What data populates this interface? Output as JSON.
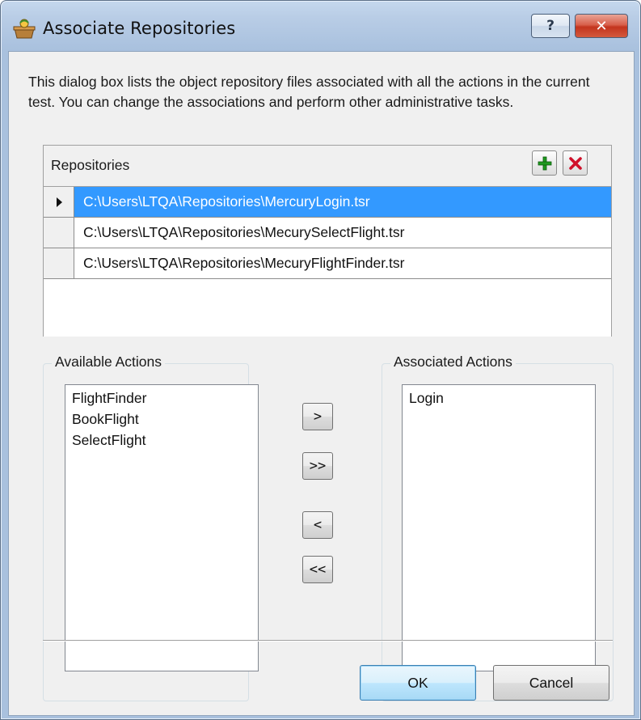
{
  "window": {
    "title": "Associate Repositories",
    "help_label": "?",
    "close_label": "✕"
  },
  "description": "This dialog box lists the object repository files associated with all the actions in the current test. You can change the associations and perform other administrative tasks.",
  "repositories": {
    "header": "Repositories",
    "add_icon": "plus-icon",
    "remove_icon": "delete-icon",
    "items": [
      "C:\\Users\\LTQA\\Repositories\\MercuryLogin.tsr",
      "C:\\Users\\LTQA\\Repositories\\MecurySelectFlight.tsr",
      "C:\\Users\\LTQA\\Repositories\\MecuryFlightFinder.tsr"
    ],
    "selected_index": 0
  },
  "available_actions": {
    "label": "Available Actions",
    "items": [
      "FlightFinder",
      "BookFlight",
      "SelectFlight"
    ]
  },
  "associated_actions": {
    "label": "Associated Actions",
    "items": [
      "Login"
    ]
  },
  "move_buttons": {
    "add_one": ">",
    "add_all": ">>",
    "remove_one": "<",
    "remove_all": "<<"
  },
  "footer": {
    "ok_label": "OK",
    "cancel_label": "Cancel"
  },
  "colors": {
    "selection": "#3399ff",
    "add_icon": "#1f9a1f",
    "delete_icon": "#d0102a"
  }
}
